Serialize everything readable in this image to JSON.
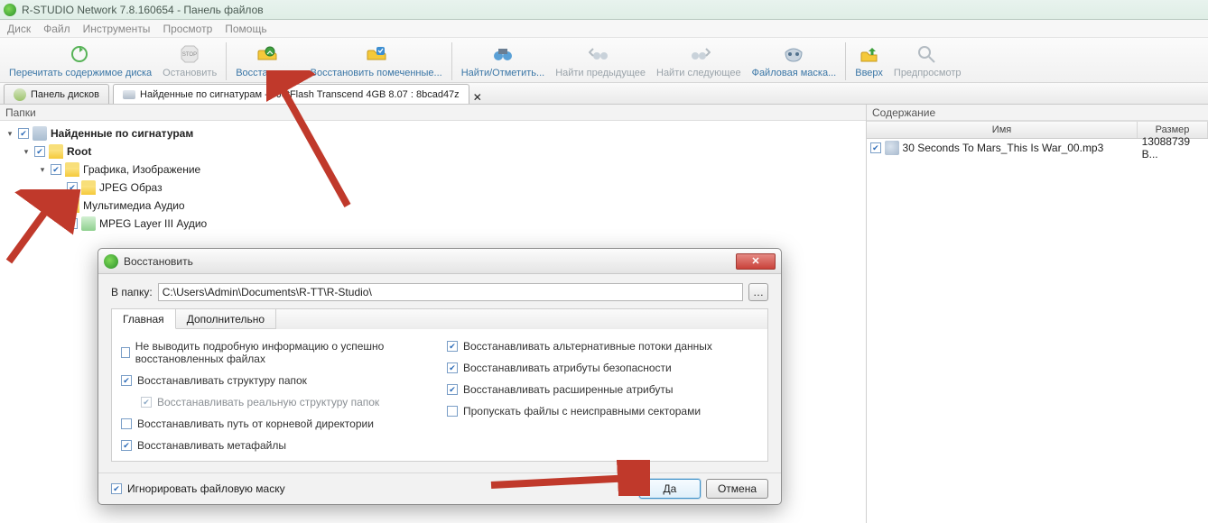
{
  "titlebar": "R-STUDIO Network 7.8.160654 - Панель файлов",
  "menu": {
    "disk": "Диск",
    "file": "Файл",
    "tools": "Инструменты",
    "view": "Просмотр",
    "help": "Помощь"
  },
  "toolbar": {
    "reread": "Перечитать содержимое диска",
    "stop": "Остановить",
    "recover": "Восстановить",
    "recover_marked": "Восстановить помеченные...",
    "find": "Найти/Отметить...",
    "find_prev": "Найти предыдущее",
    "find_next": "Найти следующее",
    "file_mask": "Файловая маска...",
    "up": "Вверх",
    "preview": "Предпросмотр"
  },
  "tabs": {
    "disks": "Панель дисков",
    "found": "Найденные по сигнатурам -> JetFlash Transcend 4GB 8.07 : 8bcad47z"
  },
  "panes": {
    "folders": "Папки",
    "content": "Содержание"
  },
  "tree": {
    "root": "Найденные по сигнатурам",
    "r2": "Root",
    "r3": "Графика, Изображение",
    "r4": "JPEG Образ",
    "r5": "Мультимедиа Аудио",
    "r6": "MPEG Layer III Аудио"
  },
  "cols": {
    "name": "Имя",
    "size": "Размер"
  },
  "file": {
    "name": "30 Seconds To Mars_This Is War_00.mp3",
    "size": "13088739 B..."
  },
  "dialog": {
    "title": "Восстановить",
    "tofolder": "В папку:",
    "path": "C:\\Users\\Admin\\Documents\\R-TT\\R-Studio\\",
    "tab_main": "Главная",
    "tab_extra": "Дополнительно",
    "opts": {
      "o1": "Не выводить подробную информацию о успешно восстановленных файлах",
      "o2": "Восстанавливать структуру папок",
      "o2a": "Восстанавливать реальную структуру папок",
      "o3": "Восстанавливать путь от корневой директории",
      "o4": "Восстанавливать метафайлы",
      "o5": "Восстанавливать альтернативные потоки данных",
      "o6": "Восстанавливать атрибуты безопасности",
      "o7": "Восстанавливать расширенные атрибуты",
      "o8": "Пропускать файлы с неисправными секторами"
    },
    "ignore_mask": "Игнорировать файловую маску",
    "ok": "Да",
    "cancel": "Отмена"
  }
}
